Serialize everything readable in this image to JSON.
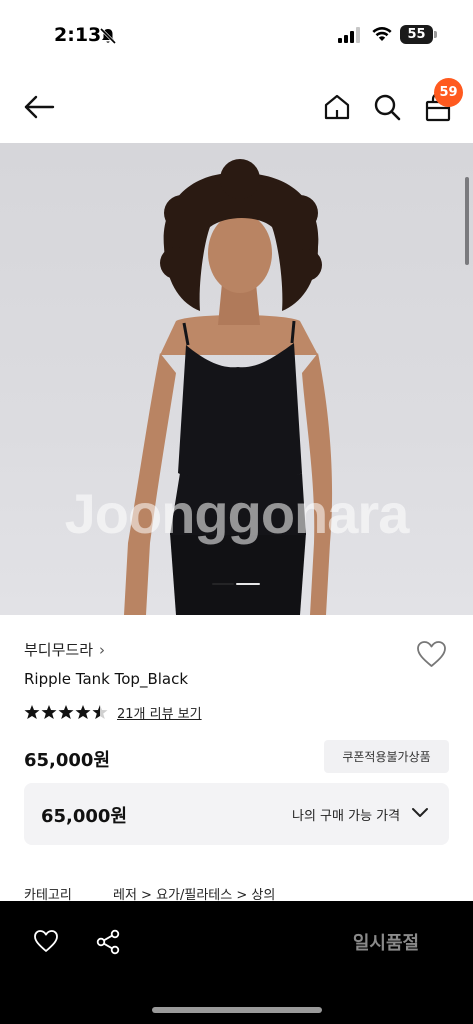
{
  "status_bar": {
    "time": "2:13",
    "battery": "55"
  },
  "header": {
    "cart_count": "59",
    "icons": [
      "back-arrow-icon",
      "home-icon",
      "search-icon",
      "cart-bag-icon"
    ]
  },
  "gallery": {
    "watermark": "Joonggonara",
    "slide_count": 2,
    "active_slide": 2
  },
  "product": {
    "brand": "부디무드라",
    "brand_chevron": "›",
    "name": "Ripple Tank Top_Black",
    "rating": 4.5,
    "review_link": "21개 리뷰 보기",
    "price": "65,000원",
    "coupon_badge": "쿠폰적용불가상품"
  },
  "price_box": {
    "value": "65,000원",
    "label": "나의 구매 가능 가격"
  },
  "category": {
    "label": "카테고리",
    "path": "레저 > 요가/필라테스 > 상의"
  },
  "bottom_bar": {
    "sold_out_label": "일시품절"
  },
  "colors": {
    "badge": "#ff5a1f",
    "bottom_bar": "#000000",
    "sold_out_text": "#8a8a8a"
  }
}
